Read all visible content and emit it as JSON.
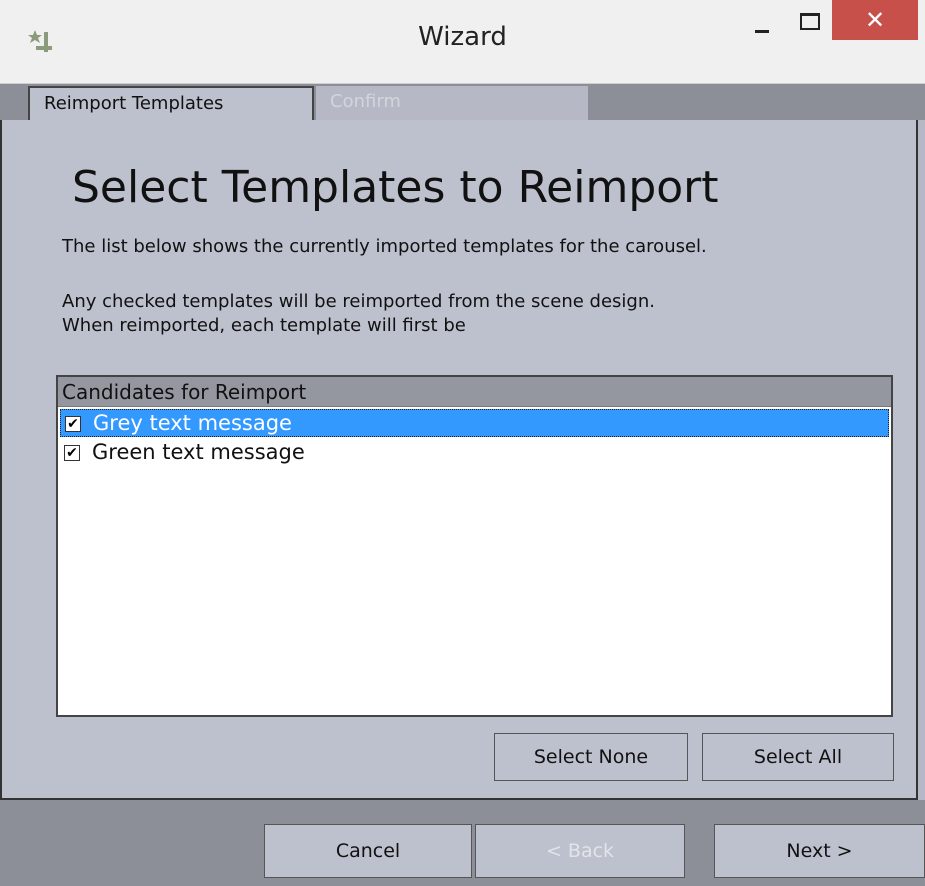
{
  "window": {
    "title": "Wizard",
    "close_glyph": "✕"
  },
  "tabs": [
    {
      "label": "Reimport Templates",
      "active": true
    },
    {
      "label": "Confirm",
      "active": false
    }
  ],
  "content": {
    "heading": "Select Templates to Reimport",
    "paragraph1": "The list below shows the currently imported templates for the carousel.",
    "paragraph2_line1": "Any checked templates will be reimported from the scene design.",
    "paragraph2_line2": "When reimported, each template will first be"
  },
  "list": {
    "header": "Candidates for Reimport",
    "items": [
      {
        "label": "Grey text message",
        "checked": true,
        "selected": true
      },
      {
        "label": "Green text message",
        "checked": true,
        "selected": false
      }
    ],
    "check_glyph": "✔"
  },
  "buttons": {
    "select_none": "Select None",
    "select_all": "Select All",
    "cancel": "Cancel",
    "back": "< Back",
    "next": "Next >"
  },
  "icons": {
    "app": "wand-icon",
    "minimize": "minimize-icon",
    "maximize": "maximize-icon",
    "close": "close-icon",
    "checkbox": "checkbox-icon"
  },
  "colors": {
    "selection": "#3399ff",
    "close_button": "#c7504b",
    "panel_bg": "#bdc0cd"
  }
}
